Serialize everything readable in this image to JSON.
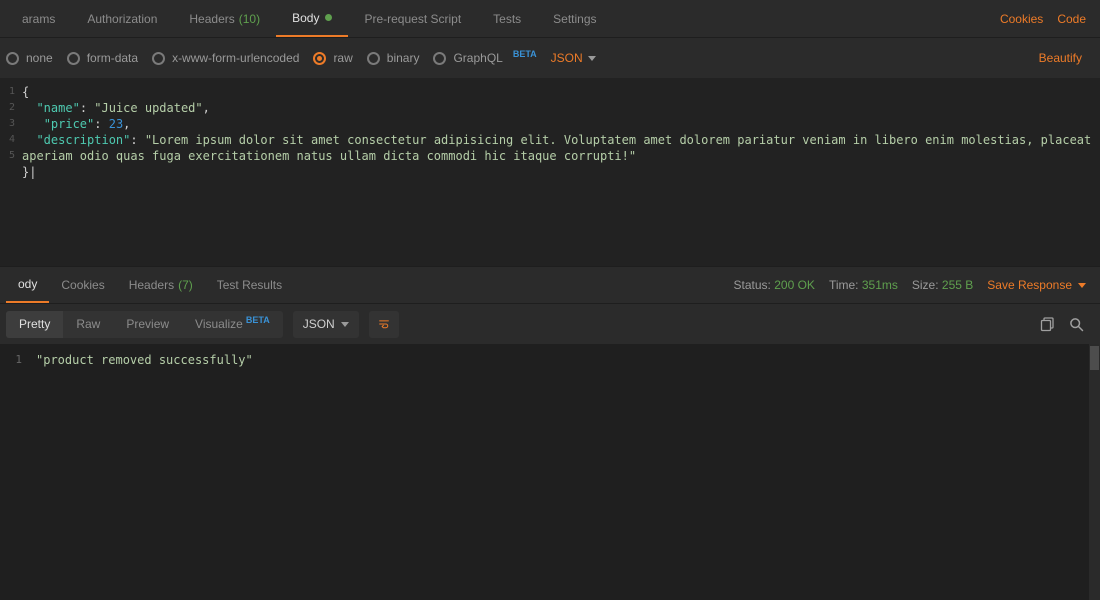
{
  "request_tabs": {
    "params": "arams",
    "authorization": "Authorization",
    "headers_label": "Headers",
    "headers_count": "(10)",
    "body": "Body",
    "prerequest": "Pre-request Script",
    "tests": "Tests",
    "settings": "Settings"
  },
  "top_links": {
    "cookies": "Cookies",
    "code": "Code"
  },
  "body_types": {
    "none": "none",
    "form_data": "form-data",
    "urlencoded": "x-www-form-urlencoded",
    "raw": "raw",
    "binary": "binary",
    "graphql": "GraphQL",
    "graphql_badge": "BETA"
  },
  "body_format": "JSON",
  "beautify": "Beautify",
  "editor": {
    "line_numbers": [
      "1",
      "2",
      "3",
      "4",
      "",
      "5"
    ],
    "open_brace": "{",
    "key_name": "\"name\"",
    "val_name": "\"Juice updated\"",
    "key_price": "\"price\"",
    "val_price": "23",
    "key_desc": "\"description\"",
    "val_desc": "\"Lorem ipsum dolor sit amet consectetur adipisicing elit. Voluptatem amet dolorem pariatur veniam in libero enim molestias, placeat aperiam odio quas fuga exercitationem natus ullam dicta commodi hic itaque corrupti!\"",
    "close_brace": "}|"
  },
  "response_tabs": {
    "body": "ody",
    "cookies": "Cookies",
    "headers_label": "Headers",
    "headers_count": "(7)",
    "test_results": "Test Results"
  },
  "response_meta": {
    "status_label": "Status:",
    "status_value": "200 OK",
    "time_label": "Time:",
    "time_value": "351ms",
    "size_label": "Size:",
    "size_value": "255 B"
  },
  "save_response": "Save Response",
  "view_modes": {
    "pretty": "Pretty",
    "raw": "Raw",
    "preview": "Preview",
    "visualize": "Visualize",
    "visualize_badge": "BETA"
  },
  "response_format": "JSON",
  "response_body": {
    "line1_num": "1",
    "line1_text": "\"product removed successfully\""
  }
}
